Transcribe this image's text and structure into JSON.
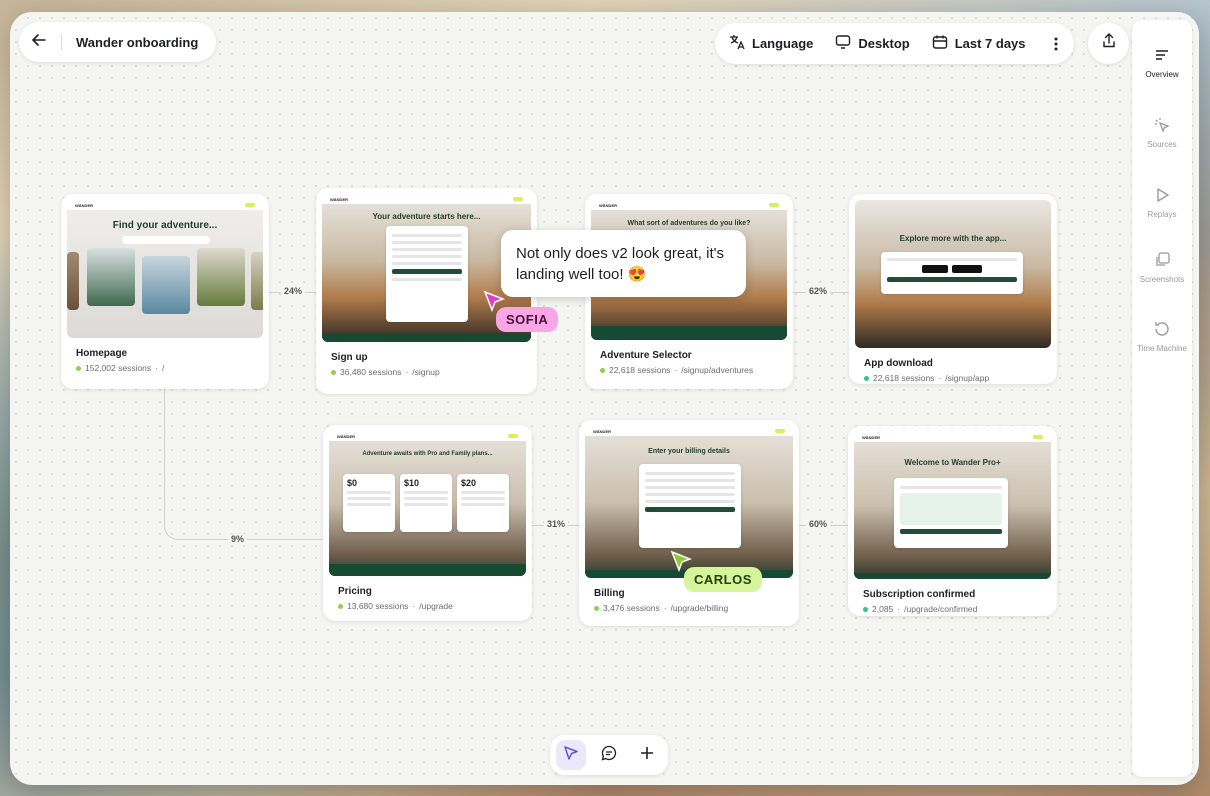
{
  "header": {
    "title": "Wander onboarding"
  },
  "controls": {
    "language": "Language",
    "device": "Desktop",
    "range": "Last 7 days"
  },
  "rail": [
    {
      "label": "Overview"
    },
    {
      "label": "Sources"
    },
    {
      "label": "Replays"
    },
    {
      "label": "Screenshots"
    },
    {
      "label": "Time Machine"
    }
  ],
  "cards": {
    "homepage": {
      "title": "Homepage",
      "sessions": "152,002 sessions",
      "path": "/",
      "headline": "Find your adventure..."
    },
    "signup": {
      "title": "Sign up",
      "sessions": "36,480 sessions",
      "path": "/signup",
      "headline": "Your adventure starts here..."
    },
    "adventure": {
      "title": "Adventure Selector",
      "sessions": "22,618 sessions",
      "path": "/signup/adventures",
      "headline": "What sort of adventures do you like?"
    },
    "app": {
      "title": "App download",
      "sessions": "22,618 sessions",
      "path": "/signup/app",
      "headline": "Explore more with the app..."
    },
    "pricing": {
      "title": "Pricing",
      "sessions": "13,680 sessions",
      "path": "/upgrade",
      "headline": "Adventure awaits with Pro and Family plans...",
      "prices": [
        "$0",
        "$10",
        "$20"
      ]
    },
    "billing": {
      "title": "Billing",
      "sessions": "3,476 sessions",
      "path": "/upgrade/billing",
      "headline": "Enter your billing details"
    },
    "confirmed": {
      "title": "Subscription confirmed",
      "sessions": "2,085",
      "path": "/upgrade/confirmed",
      "headline": "Welcome to Wander Pro+"
    }
  },
  "brand": "WÄNDER",
  "connectors": {
    "home_signup": "24%",
    "adventure_app": "62%",
    "home_pricing": "9%",
    "pricing_billing": "31%",
    "billing_confirmed": "60%"
  },
  "comment": {
    "text": "Not only does v2 look great, it's landing well too! 😍"
  },
  "cursors": {
    "sofia": "SOFIA",
    "carlos": "CARLOS"
  },
  "colors": {
    "accent": "#d6f05a",
    "brand_green": "#164a33",
    "sofia": "#f7a6e6",
    "carlos": "#d6f49a"
  }
}
